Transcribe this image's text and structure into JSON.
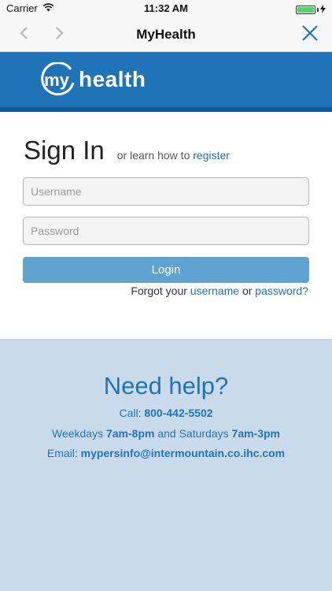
{
  "status_bar": {
    "carrier": "Carrier",
    "time": "11:32 AM",
    "battery_level": 1.0,
    "battery_color": "#4cd964"
  },
  "nav": {
    "title": "MyHealth",
    "back_icon": "chevron-left-icon",
    "forward_icon": "chevron-right-icon",
    "close_icon": "close-icon"
  },
  "brand": {
    "logo_circle_text": "my",
    "logo_text": "health",
    "color": "#1f73b7"
  },
  "signin": {
    "title": "Sign In",
    "subtitle_prefix": "or learn how to",
    "register_link": "register",
    "username_placeholder": "Username",
    "password_placeholder": "Password",
    "login_label": "Login",
    "forgot_prefix": "Forgot your",
    "forgot_username": "username",
    "forgot_or": "or",
    "forgot_password": "password?"
  },
  "help": {
    "title": "Need help?",
    "call_label": "Call:",
    "call_number": "800-442-5502",
    "weekdays_label": "Weekdays",
    "weekdays_hours": "7am-8pm",
    "saturdays_label": "and Saturdays",
    "saturdays_hours": "7am-3pm",
    "email_label": "Email:",
    "email_address": "mypersinfo@intermountain.co.ihc.com"
  }
}
